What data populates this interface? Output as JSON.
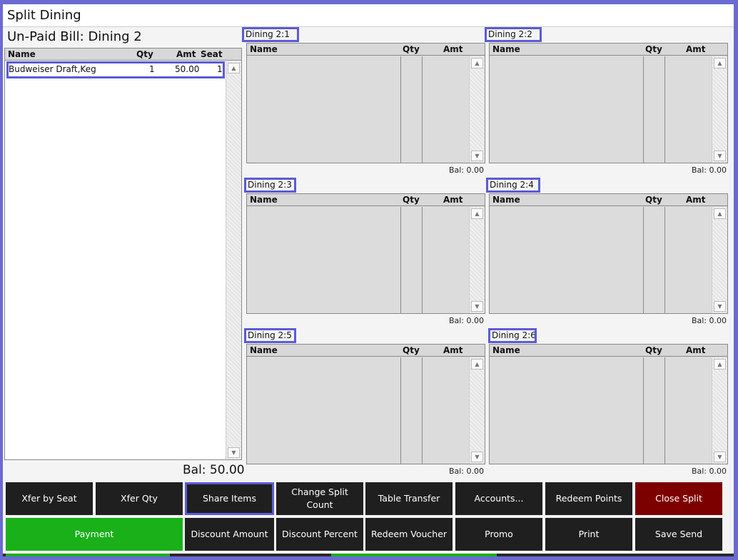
{
  "window": {
    "title": "Split Dining"
  },
  "bill": {
    "title": "Un-Paid Bill: Dining 2",
    "columns": {
      "name": "Name",
      "qty": "Qty",
      "amt": "Amt",
      "seat": "Seat"
    },
    "items": [
      {
        "name": "Budweiser Draft,Keg",
        "qty": "1",
        "amt": "50.00",
        "seat": "1"
      }
    ],
    "balance": "Bal: 50.00"
  },
  "split_columns": {
    "name": "Name",
    "qty": "Qty",
    "amt": "Amt"
  },
  "splits": [
    {
      "label": "Dining 2:1",
      "balance": "Bal: 0.00"
    },
    {
      "label": "Dining 2:2",
      "balance": "Bal: 0.00"
    },
    {
      "label": "Dining 2:3",
      "balance": "Bal: 0.00"
    },
    {
      "label": "Dining 2:4",
      "balance": "Bal: 0.00"
    },
    {
      "label": "Dining 2:5",
      "balance": "Bal: 0.00"
    },
    {
      "label": "Dining 2:6",
      "balance": "Bal: 0.00"
    }
  ],
  "buttons": {
    "xfer_by_seat": "Xfer by Seat",
    "xfer_qty": "Xfer Qty",
    "share_items": "Share Items",
    "change_split_count": "Change Split Count",
    "table_transfer": "Table Transfer",
    "accounts": "Accounts...",
    "redeem_points": "Redeem Points",
    "close_split": "Close Split",
    "payment": "Payment",
    "discount_amount": "Discount Amount",
    "discount_percent": "Discount Percent",
    "redeem_voucher": "Redeem Voucher",
    "promo": "Promo",
    "print": "Print",
    "save_send": "Save Send"
  },
  "icons": {
    "scroll_up": "scroll-up-arrow-icon",
    "scroll_down": "scroll-down-arrow-icon"
  },
  "colors": {
    "highlight": "#5b5bd6",
    "button_dark": "#1f1f1f",
    "button_green": "#19b019",
    "button_red": "#7d0000"
  }
}
